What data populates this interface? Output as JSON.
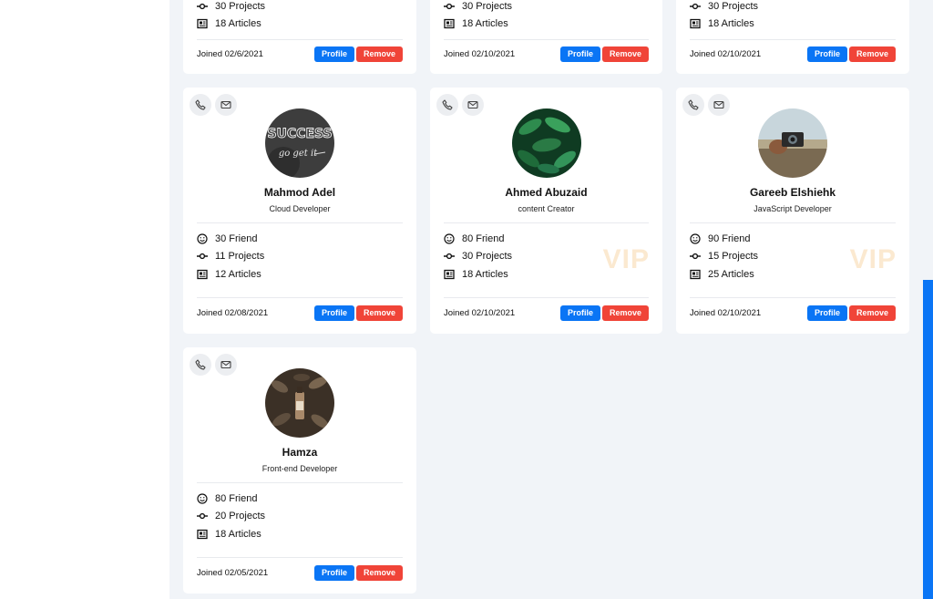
{
  "colors": {
    "accent": "#0a75f5",
    "danger": "#f04438",
    "vip": "#fbe9d0",
    "background": "#f1f4f8"
  },
  "partial_cards": [
    {
      "projects_cut": "30 Projects",
      "articles": "18 Articles",
      "joined": "Joined 02/6/2021",
      "profile": "Profile",
      "remove": "Remove"
    },
    {
      "projects_cut": "30 Projects",
      "articles": "18 Articles",
      "joined": "Joined 02/10/2021",
      "profile": "Profile",
      "remove": "Remove"
    },
    {
      "projects_cut": "30 Projects",
      "articles": "18 Articles",
      "joined": "Joined 02/10/2021",
      "profile": "Profile",
      "remove": "Remove"
    }
  ],
  "cards": [
    {
      "name": "Mahmod Adel",
      "role": "Cloud Developer",
      "friends": "30 Friend",
      "projects": "11 Projects",
      "articles": "12 Articles",
      "vip": "",
      "joined": "Joined 02/08/2021",
      "profile": "Profile",
      "remove": "Remove",
      "avatar_icon": "success-chalkboard-avatar"
    },
    {
      "name": "Ahmed Abuzaid",
      "role": "content Creator",
      "friends": "80 Friend",
      "projects": "30 Projects",
      "articles": "18 Articles",
      "vip": "VIP",
      "joined": "Joined 02/10/2021",
      "profile": "Profile",
      "remove": "Remove",
      "avatar_icon": "leaves-avatar"
    },
    {
      "name": "Gareeb Elshiehk",
      "role": "JavaScript Developer",
      "friends": "90 Friend",
      "projects": "15 Projects",
      "articles": "25 Articles",
      "vip": "VIP",
      "joined": "Joined 02/10/2021",
      "profile": "Profile",
      "remove": "Remove",
      "avatar_icon": "camera-avatar"
    },
    {
      "name": "Hamza",
      "role": "Front-end Developer",
      "friends": "80 Friend",
      "projects": "20 Projects",
      "articles": "18 Articles",
      "vip": "",
      "joined": "Joined 02/05/2021",
      "profile": "Profile",
      "remove": "Remove",
      "avatar_icon": "bottle-avatar"
    }
  ],
  "icons": {
    "phone": "phone-icon",
    "mail": "mail-icon",
    "friend": "smile-icon",
    "project": "commit-icon",
    "article": "newspaper-icon"
  }
}
